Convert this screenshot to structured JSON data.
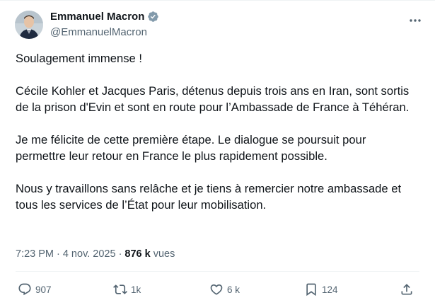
{
  "author": {
    "name": "Emmanuel Macron",
    "handle": "@EmmanuelMacron",
    "verified_color": "#829aab"
  },
  "tweet": {
    "paragraphs": [
      "Soulagement immense !",
      "Cécile Kohler et Jacques Paris, détenus depuis trois ans en Iran, sont sortis de la prison d'Evin et sont en route pour l’Ambassade de France à Téhéran.",
      "Je me félicite de cette première étape. Le dialogue se poursuit pour permettre leur retour en France le plus rapidement possible.",
      "Nous y travaillons sans relâche et je tiens à remercier notre ambassade et tous les services de l’État pour leur mobilisation."
    ]
  },
  "meta": {
    "time": "7:23 PM",
    "separator": "·",
    "date": "4 nov. 2025",
    "views_count": "876 k",
    "views_label": "vues"
  },
  "actions": {
    "replies": "907",
    "reposts": "1k",
    "likes": "6 k",
    "bookmarks": "124"
  },
  "icons": {
    "more": "more-horizontal-icon",
    "reply": "reply-icon",
    "repost": "repost-icon",
    "like": "heart-icon",
    "bookmark": "bookmark-icon",
    "share": "share-icon",
    "verified": "verified-badge-icon"
  },
  "colors": {
    "text": "#0f1419",
    "secondary": "#536471",
    "divider": "#eff3f4"
  }
}
